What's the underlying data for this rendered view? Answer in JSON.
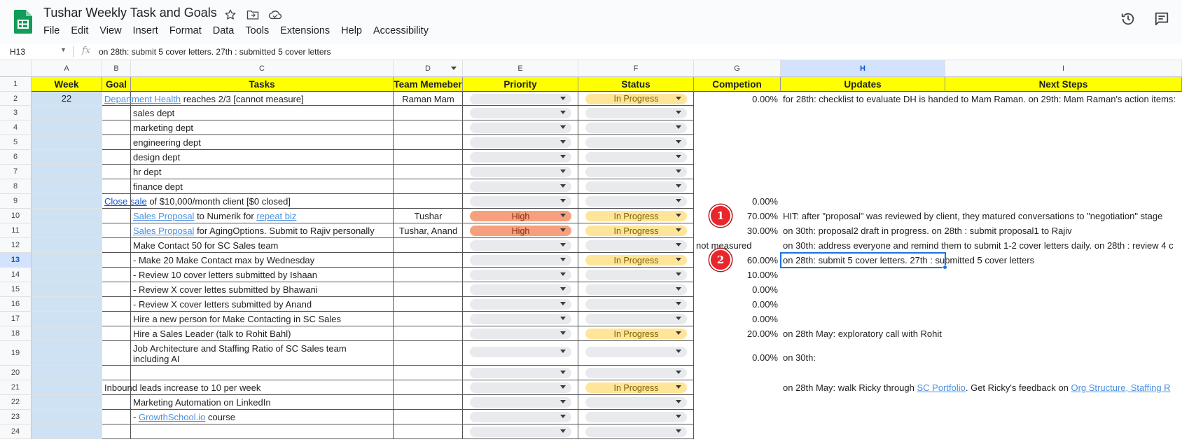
{
  "app": {
    "title": "Tushar Weekly Task and Goals",
    "menu": [
      "File",
      "Edit",
      "View",
      "Insert",
      "Format",
      "Data",
      "Tools",
      "Extensions",
      "Help",
      "Accessibility"
    ]
  },
  "formula_bar": {
    "cell_ref": "H13",
    "content": "on 28th: submit 5 cover letters. 27th : submitted 5 cover letters"
  },
  "columns": [
    "A",
    "B",
    "C",
    "D",
    "E",
    "F",
    "G",
    "H",
    "I"
  ],
  "selected_column": "H",
  "selected_row": "13",
  "rows": [
    "1",
    "2",
    "3",
    "4",
    "5",
    "6",
    "7",
    "8",
    "9",
    "10",
    "11",
    "12",
    "13",
    "14",
    "15",
    "16",
    "17",
    "18",
    "19",
    "20",
    "21",
    "22",
    "23",
    "24"
  ],
  "headers": {
    "week": "Week",
    "goal": "Goal",
    "tasks": "Tasks",
    "team": "Team Memeber",
    "priority": "Priority",
    "status": "Status",
    "completion": "Competion",
    "updates": "Updates",
    "next_steps": "Next Steps"
  },
  "cells": {
    "a2": "22",
    "b2_link": "Department Health",
    "b2_rest": " reaches 2/3 [cannot measure]",
    "d2": "Raman Mam",
    "g2": "0.00%",
    "h2": "for 28th: checklist to evaluate DH is handed to Mam Raman. on 29th: Mam Raman's action items:",
    "c3": "sales dept",
    "c4": "marketing dept",
    "c5": "engineering dept",
    "c6": "design dept",
    "c7": "hr dept",
    "c8": "finance dept",
    "b9_link": "Close sale",
    "b9_rest": " of $10,000/month client [$0 closed]",
    "g9": "0.00%",
    "c10_link1": "Sales Proposal",
    "c10_mid": " to Numerik for ",
    "c10_link2": "repeat biz",
    "d10": "Tushar",
    "g10": "70.00%",
    "h10": "HIT: after \"proposal\" was reviewed by client, they matured conversations to \"negotiation\" stage",
    "c11_link": "Sales Proposal",
    "c11_rest": " for AgingOptions. Submit to Rajiv personally",
    "d11": "Tushar, Anand",
    "g11": "30.00%",
    "h11": "on 30th: proposal2 draft in progress. on 28th : submit proposal1 to Rajiv",
    "c12": "Make Contact 50 for SC Sales team",
    "g12": "not measured",
    "h12": "on 30th: address everyone and remind them to submit 1-2 cover letters daily. on 28th : review 4 c",
    "c13": "- Make 20 Make Contact max by Wednesday",
    "g13": "60.00%",
    "h13": "on 28th: submit 5 cover letters. 27th : submitted 5 cover letters",
    "c14": "- Review 10 cover letters submitted by Ishaan",
    "g14": "10.00%",
    "c15": "- Review X cover lettes submitted by Bhawani",
    "g15": "0.00%",
    "c16": "- Review X cover letters submitted by Anand",
    "g16": "0.00%",
    "c17": "Hire a new person for Make Contacting in SC Sales",
    "g17": "0.00%",
    "c18": "Hire a Sales Leader (talk to Rohit Bahl)",
    "g18": "20.00%",
    "h18": "on 28th May: exploratory call with Rohit",
    "c19_line1": "Job Architecture and Staffing Ratio of SC Sales team",
    "c19_line2": "including AI",
    "g19": "0.00%",
    "h19": "on 30th:",
    "b21": "Inbound leads increase to 10 per week",
    "h21_pre": "on 28th May: walk Ricky through ",
    "h21_link1": "SC Portfolio",
    "h21_mid": ". Get Ricky's feedback on ",
    "h21_link2": "Org Structure, Staffing R",
    "c22": "Marketing Automation on LinkedIn",
    "c23_pre": "- ",
    "c23_link": "GrowthSchool.io",
    "c23_rest": " course"
  },
  "chips": {
    "in_progress": "In Progress",
    "high": "High"
  },
  "markers": [
    "1",
    "2"
  ],
  "colors": {
    "header_yellow": "#ffff00",
    "week_blue": "#cfe2f3",
    "chip_progress": "#ffe599",
    "chip_high": "#f6a07d",
    "marker_red": "#e8262b",
    "selection": "#1a73e8"
  },
  "icons": [
    "sheets-logo-icon",
    "star-icon",
    "move-folder-icon",
    "cloud-status-icon",
    "history-icon",
    "comments-icon"
  ]
}
